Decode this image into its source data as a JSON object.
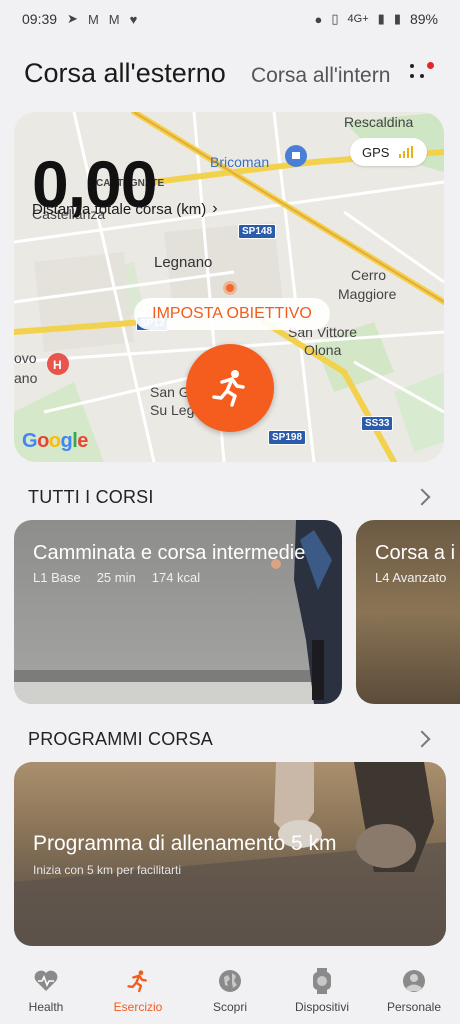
{
  "status_bar": {
    "time": "09:39",
    "network": "4G+",
    "battery": "89%",
    "icons": [
      "telegram-icon",
      "gmail-icon",
      "gmail-icon",
      "heart-icon",
      "location-icon",
      "vibrate-icon",
      "signal-icon",
      "battery-icon"
    ]
  },
  "header": {
    "title_active": "Corsa all'esterno",
    "title_next": "Corsa all'intern"
  },
  "map": {
    "distance_value": "0,00",
    "distance_label": "Distanza totale corsa (km)",
    "gps_label": "GPS",
    "goal_button": "IMPOSTA OBIETTIVO",
    "google": "Google",
    "places": {
      "rescaldina": "Rescaldina",
      "bricoman": "Bricoman",
      "castegnate": "CASTEGNATE",
      "castellanza": "Castellanza",
      "legnano": "Legnano",
      "cerro": "Cerro",
      "maggiore": "Maggiore",
      "san_vittore": "San Vittore",
      "olona": "Olona",
      "ovo": "ovo",
      "ano": "ano",
      "san_g": "San G",
      "su_leg": "Su Leg"
    },
    "roads": {
      "sp148": "SP148",
      "sp12": "SP12",
      "ss33": "SS33",
      "sp198": "SP198"
    },
    "colors": {
      "accent": "#f55d1f",
      "gps_bars": "#e8b214"
    }
  },
  "all_courses": {
    "title": "TUTTI I CORSI",
    "cards": [
      {
        "title": "Camminata e corsa intermedie",
        "level": "L1 Base",
        "duration": "25 min",
        "kcal": "174 kcal"
      },
      {
        "title": "Corsa a i",
        "level": "L4 Avanzato"
      }
    ]
  },
  "programs": {
    "title": "PROGRAMMI CORSA",
    "card": {
      "title": "Programma di allenamento 5 km",
      "subtitle": "Inizia con 5 km per facilitarti"
    }
  },
  "bottom_nav": {
    "items": [
      {
        "label": "Health",
        "icon": "health-icon"
      },
      {
        "label": "Esercizio",
        "icon": "running-icon"
      },
      {
        "label": "Scopri",
        "icon": "globe-icon"
      },
      {
        "label": "Dispositivi",
        "icon": "watch-icon"
      },
      {
        "label": "Personale",
        "icon": "person-icon"
      }
    ],
    "active_index": 1,
    "active_color": "#f25c1c"
  }
}
